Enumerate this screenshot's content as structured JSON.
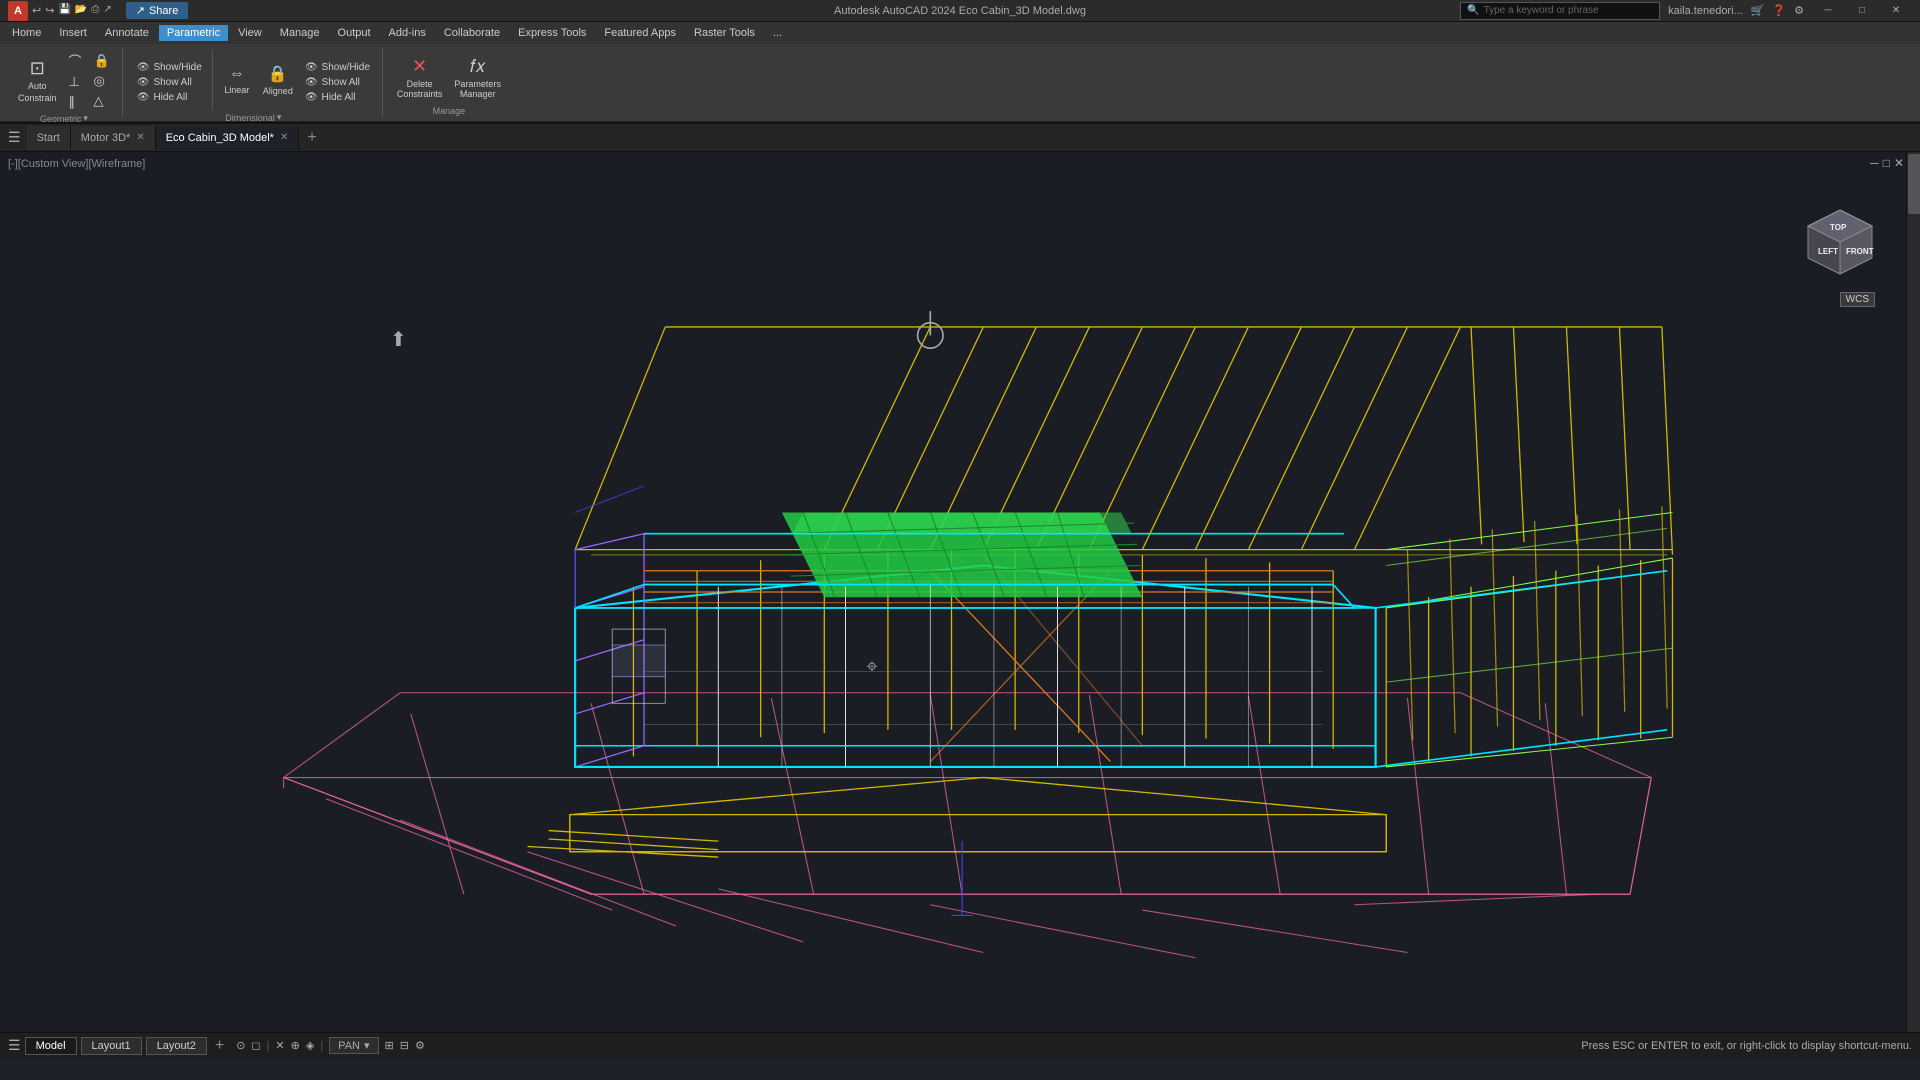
{
  "titlebar": {
    "left_icons": "A ↩ ↪ □ □ □ □ □ □",
    "title": "Autodesk AutoCAD 2024  Eco Cabin_3D Model.dwg",
    "search_placeholder": "Type a keyword or phrase",
    "user": "kaila.tenedori...",
    "win_minimize": "─",
    "win_maximize": "□",
    "win_close": "✕",
    "share_label": "Share"
  },
  "menu": {
    "items": [
      "Home",
      "Insert",
      "Annotate",
      "Parametric",
      "View",
      "Manage",
      "Output",
      "Add-ins",
      "Collaborate",
      "Express Tools",
      "Featured Apps",
      "Raster Tools",
      "..."
    ]
  },
  "ribbon": {
    "active_tab": "Parametric",
    "groups": [
      {
        "label": "Geometric",
        "items": [
          "Auto\nConstrain"
        ]
      },
      {
        "label": "Dimensional",
        "items": [
          "Show/Hide",
          "Show All",
          "Hide All",
          "Linear",
          "Aligned"
        ]
      },
      {
        "label": "Manage",
        "items": [
          "Delete\nConstraints",
          "Parameters\nManager"
        ]
      }
    ]
  },
  "tabs": {
    "items": [
      "Start",
      "Motor 3D*",
      "Eco Cabin_3D Model*"
    ],
    "active": "Eco Cabin_3D Model*"
  },
  "viewport": {
    "label": "[-][Custom View][Wireframe]",
    "maximize": "□",
    "close": "✕"
  },
  "viewcube": {
    "left": "LEFT",
    "front": "FRONT"
  },
  "wcs": "WCS",
  "statusbar": {
    "model_tabs": [
      "Model",
      "Layout1",
      "Layout2"
    ],
    "active_tab": "Model",
    "add_layout": "+",
    "pan_mode": "PAN",
    "status_text": "Press ESC or ENTER to exit, or right-click to display shortcut-menu.",
    "icons": [
      "☰",
      "⊙",
      "🔷",
      "△",
      "□",
      "◈",
      "⌗",
      "∿",
      "⊞",
      "⋮"
    ]
  }
}
